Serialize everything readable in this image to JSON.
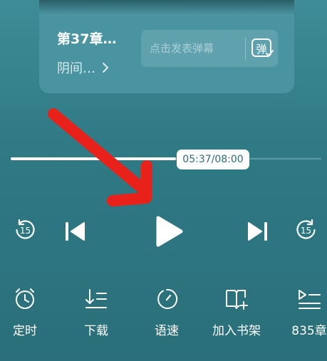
{
  "now_playing": {
    "chapter_title": "第37章…",
    "subtitle": "阴间…",
    "danmu_placeholder": "点击发表弹幕",
    "danmu_button_label": "弹"
  },
  "progress": {
    "time_label": "05:37/08:00",
    "fraction": 0.7
  },
  "controls": {
    "rewind_seconds": "15",
    "forward_seconds": "15"
  },
  "bottom_bar": [
    {
      "label": "定时",
      "icon": "alarm-clock-icon"
    },
    {
      "label": "下载",
      "icon": "download-list-icon"
    },
    {
      "label": "语速",
      "icon": "speed-dial-icon"
    },
    {
      "label": "加入书架",
      "icon": "add-bookshelf-icon"
    },
    {
      "label": "835章",
      "icon": "chapter-list-icon"
    }
  ],
  "colors": {
    "background": "#2f7a85",
    "card": "#4a93a0",
    "annotation_arrow": "#e8221b"
  }
}
